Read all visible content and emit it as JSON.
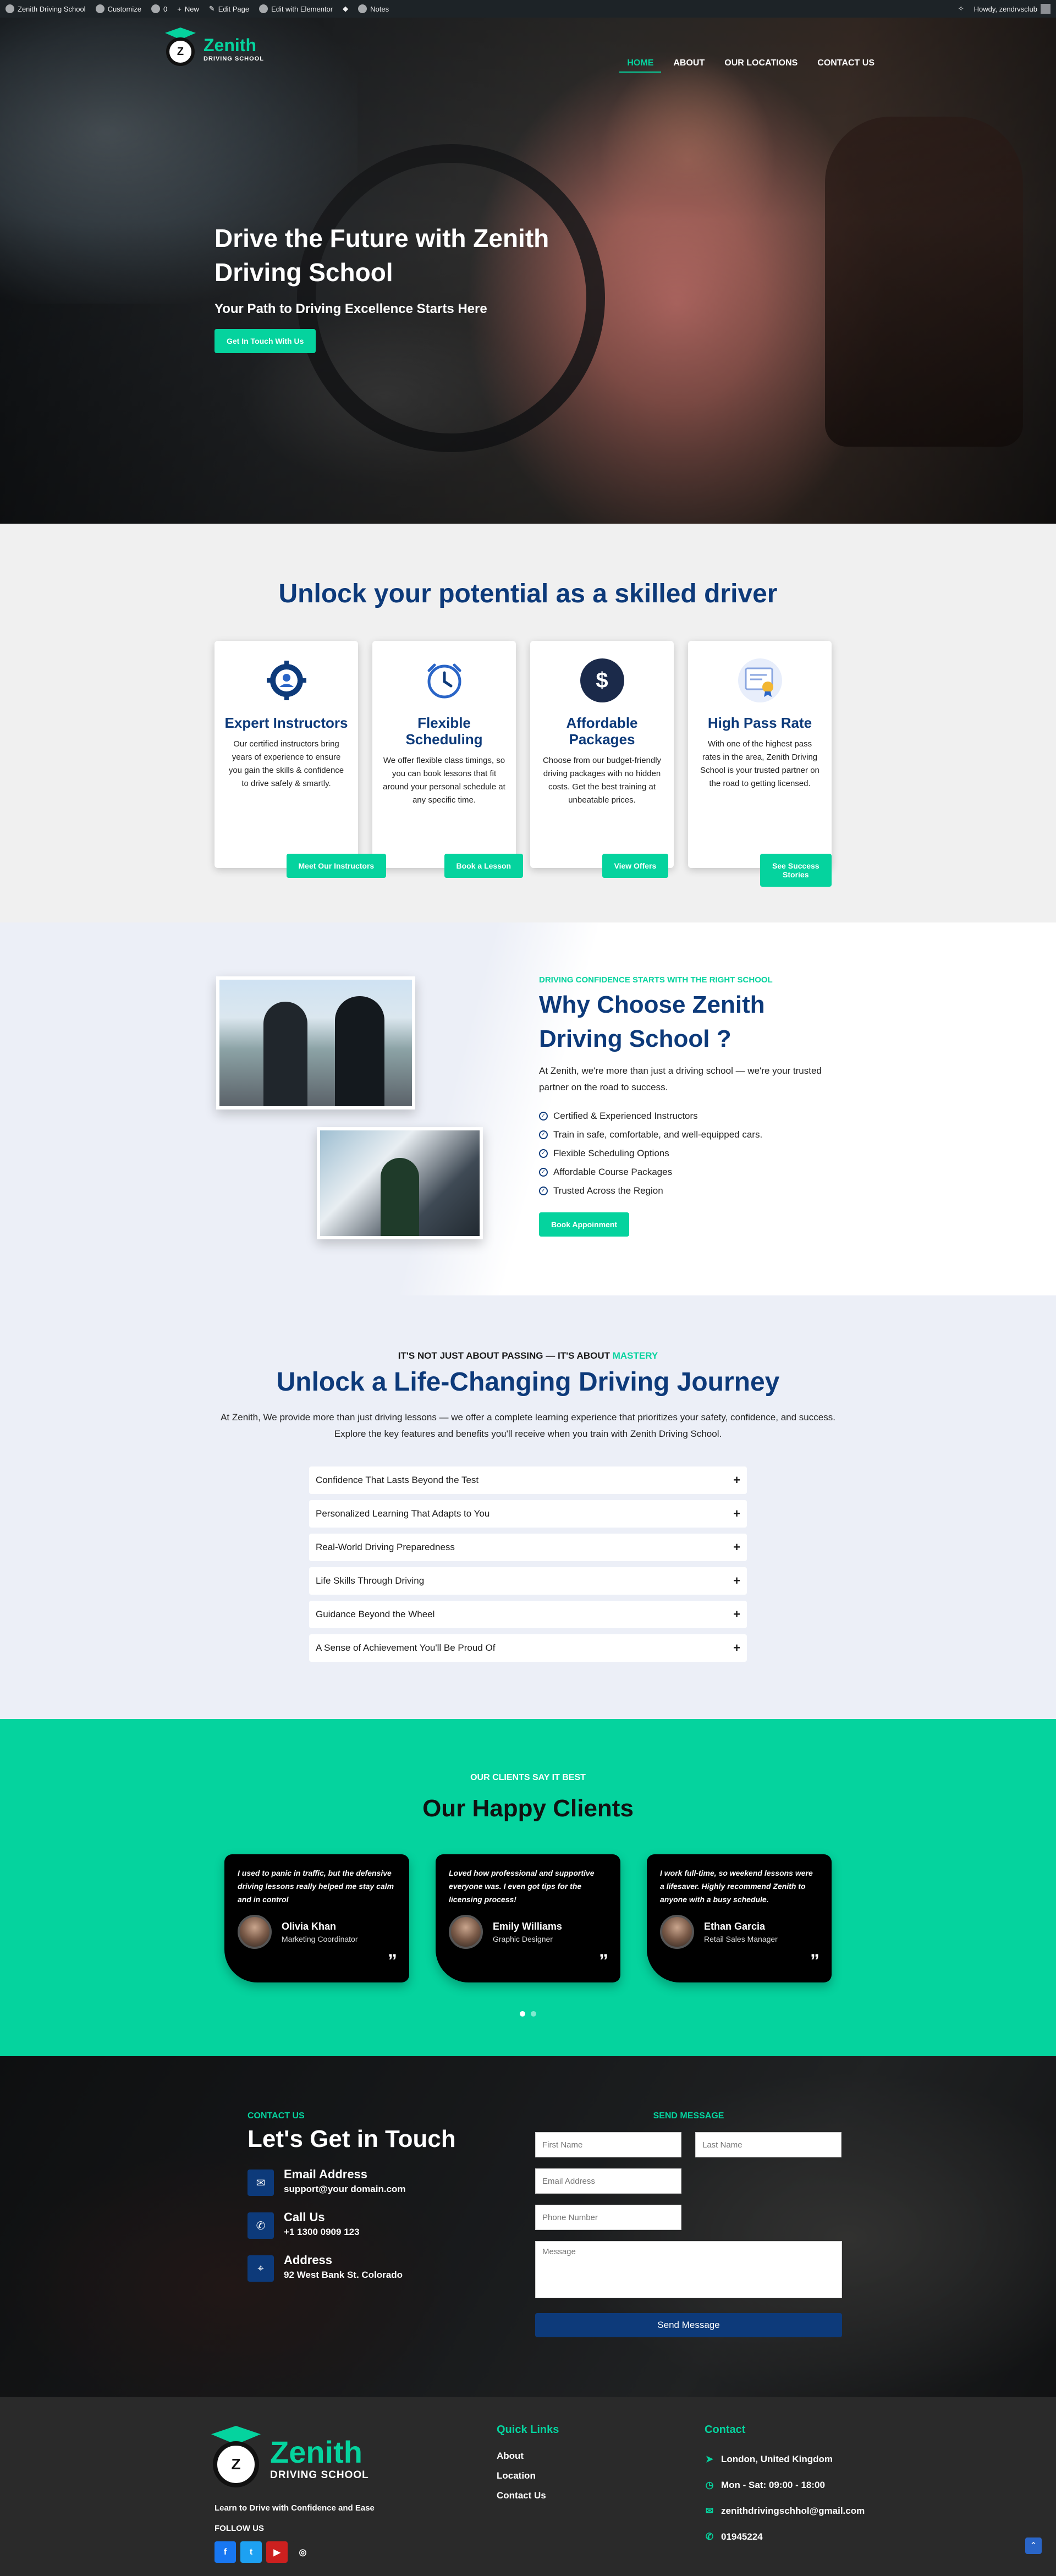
{
  "adminbar": {
    "site": "Zenith Driving School",
    "customize": "Customize",
    "comments": "0",
    "new": "New",
    "edit_page": "Edit Page",
    "edit_elementor": "Edit with Elementor",
    "notes": "Notes",
    "howdy": "Howdy, zendrvsclub"
  },
  "header": {
    "brand": "Zenith",
    "brand_sub": "DRIVING SCHOOL",
    "nav": [
      "HOME",
      "ABOUT",
      "OUR LOCATIONS",
      "CONTACT US"
    ]
  },
  "hero": {
    "title": "Drive the Future with Zenith Driving School",
    "subtitle": "Your Path to Driving Excellence Starts Here",
    "cta": "Get In Touch With Us"
  },
  "features": {
    "title": "Unlock your potential as a skilled driver",
    "cards": [
      {
        "icon": "gear-person-icon",
        "title": "Expert Instructors",
        "text": "Our certified instructors bring years of experience to ensure you gain the skills & confidence to drive safely & smartly.",
        "button": "Meet Our Instructors"
      },
      {
        "icon": "clock-icon",
        "title": "Flexible Scheduling",
        "text": "We offer flexible class timings, so you can book lessons that fit around your personal schedule at any specific time.",
        "button": "Book a Lesson"
      },
      {
        "icon": "dollar-icon",
        "title": "Affordable Packages",
        "text": "Choose from our budget-friendly driving packages with no hidden costs. Get the best training at unbeatable prices.",
        "button": "View Offers"
      },
      {
        "icon": "certificate-icon",
        "title": "High Pass Rate",
        "text": "With one of the highest pass rates in the area, Zenith Driving School is your trusted partner on the road to getting licensed.",
        "button": "See Success Stories"
      }
    ]
  },
  "why": {
    "eyebrow": "DRIVING CONFIDENCE STARTS WITH THE RIGHT SCHOOL",
    "title": "Why Choose Zenith Driving School ?",
    "text": "At Zenith, we're more than just a driving school — we're your trusted partner on the road to success.",
    "list": [
      "Certified & Experienced Instructors",
      "Train in safe, comfortable, and well-equipped cars.",
      "Flexible Scheduling Options",
      "Affordable Course Packages",
      "Trusted Across the Region"
    ],
    "cta": "Book Appoinment"
  },
  "journey": {
    "eyebrow": "IT'S NOT JUST ABOUT PASSING — IT'S ABOUT",
    "eyebrow_highlight": "MASTERY",
    "title": "Unlock a Life-Changing Driving Journey",
    "intro": "At Zenith, We provide more than just driving lessons — we offer a complete learning experience that prioritizes your safety, confidence, and success. Explore the key features and benefits you'll receive when you train with Zenith Driving School.",
    "items": [
      "Confidence That Lasts Beyond the Test",
      "Personalized Learning That Adapts to You",
      "Real-World Driving Preparedness",
      "Life Skills Through Driving",
      "Guidance Beyond the Wheel",
      "A Sense of Achievement You'll Be Proud Of"
    ]
  },
  "testimonials": {
    "eyebrow": "OUR CLIENTS SAY IT BEST",
    "title": "Our Happy Clients",
    "items": [
      {
        "quote": "I used to panic in traffic, but the defensive driving lessons really helped me stay calm and in control",
        "name": "Olivia Khan",
        "role": "Marketing Coordinator"
      },
      {
        "quote": "Loved how professional and supportive everyone was. I even got tips for the licensing process!",
        "name": "Emily Williams",
        "role": "Graphic Designer"
      },
      {
        "quote": "I work full-time, so weekend lessons were a lifesaver. Highly recommend Zenith to anyone with a busy schedule.",
        "name": "Ethan Garcia",
        "role": "Retail Sales Manager"
      }
    ]
  },
  "contact": {
    "eyebrow": "CONTACT US",
    "title": "Let's Get in Touch",
    "info": [
      {
        "icon": "envelope-icon",
        "title": "Email Address",
        "value": "support@your domain.com"
      },
      {
        "icon": "phone-icon",
        "title": "Call Us",
        "value": "+1 1300 0909 123"
      },
      {
        "icon": "location-pin-icon",
        "title": "Address",
        "value": "92 West Bank St. Colorado"
      }
    ],
    "form": {
      "eyebrow": "SEND MESSAGE",
      "first_name": "First Name",
      "last_name": "Last Name",
      "email": "Email Address",
      "phone": "Phone Number",
      "message": "Message",
      "submit": "Send Message"
    }
  },
  "footer": {
    "brand": "Zenith",
    "brand_sub": "DRIVING SCHOOL",
    "tagline": "Learn to Drive with Confidence and Ease",
    "follow": "FOLLOW US",
    "social": [
      {
        "icon": "facebook-icon",
        "color": "#1877f2",
        "glyph": "f"
      },
      {
        "icon": "twitter-icon",
        "color": "#1da1f2",
        "glyph": "t"
      },
      {
        "icon": "youtube-icon",
        "color": "#cd201f",
        "glyph": "▶"
      },
      {
        "icon": "instagram-icon",
        "color": "#2a2a2a",
        "glyph": "◎"
      }
    ],
    "links_title": "Quick Links",
    "links": [
      "About",
      "Location",
      "Contact Us"
    ],
    "contact_title": "Contact",
    "contact": [
      {
        "icon": "navigation-icon",
        "text": "London, United Kingdom"
      },
      {
        "icon": "clock-icon",
        "text": "Mon - Sat: 09:00 - 18:00"
      },
      {
        "icon": "envelope-icon",
        "text": "zenithdrivingschhol@gmail.com"
      },
      {
        "icon": "phone-icon",
        "text": "01945224"
      }
    ]
  },
  "colors": {
    "accent": "#05d39e",
    "navy": "#0d3a7a",
    "footer_bg": "#2a2a2a"
  }
}
